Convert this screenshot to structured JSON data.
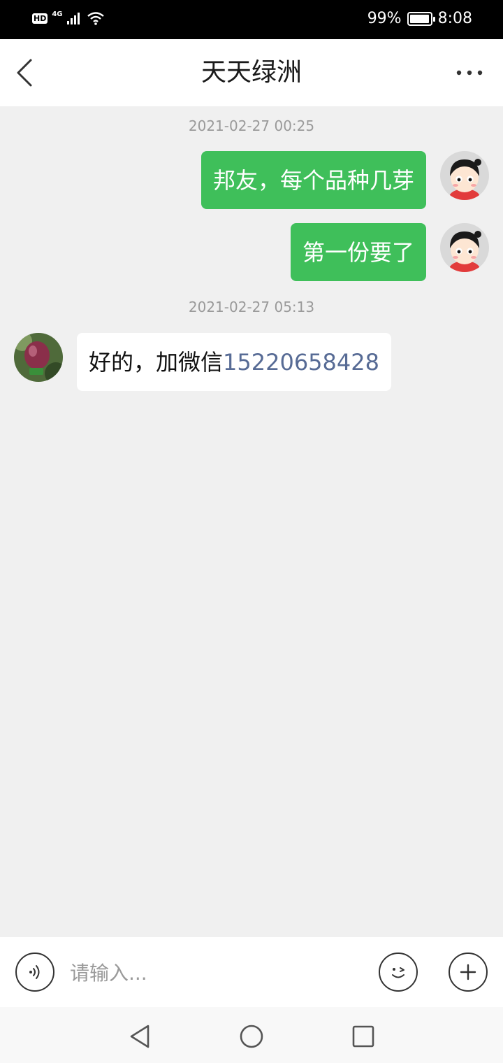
{
  "status_bar": {
    "hd": "HD",
    "network": "4G",
    "battery": "99%",
    "battery_level": 0.99,
    "time": "8:08"
  },
  "header": {
    "title": "天天绿洲",
    "back_icon": "chevron-left-icon",
    "more_icon": "more-dots-icon"
  },
  "chat": {
    "timestamps": [
      "2021-02-27 00:25",
      "2021-02-27 05:13"
    ],
    "messages": [
      {
        "sender": "me",
        "text": "邦友，每个品种几芽"
      },
      {
        "sender": "me",
        "text": "第一份要了"
      },
      {
        "sender": "them",
        "text": "好的，加微信",
        "link": "15220658428"
      }
    ]
  },
  "input_bar": {
    "placeholder": "请输入...",
    "voice_icon": "voice-icon",
    "emoji_icon": "emoji-icon",
    "add_icon": "plus-icon"
  },
  "colors": {
    "my_bubble": "#3fbf5a",
    "link": "#576b95",
    "background": "#f0f0f0"
  }
}
